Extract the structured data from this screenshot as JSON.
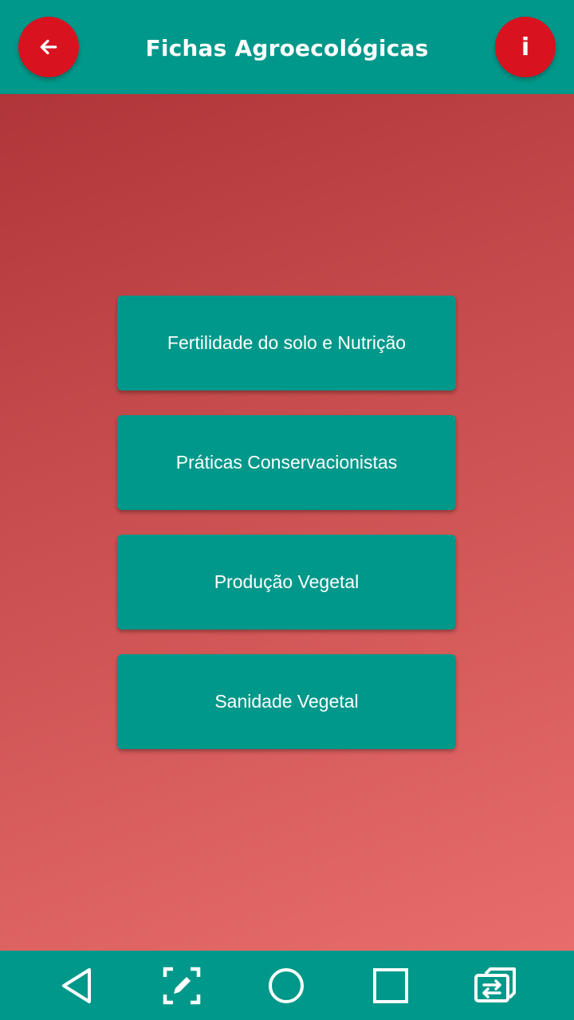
{
  "header": {
    "title": "Fichas Agroecológicas",
    "back_icon": "arrow-left-icon",
    "info_label": "i"
  },
  "menu": {
    "items": [
      {
        "label": "Fertilidade do solo e Nutrição"
      },
      {
        "label": "Práticas Conservacionistas"
      },
      {
        "label": "Produção Vegetal"
      },
      {
        "label": "Sanidade Vegetal"
      }
    ]
  },
  "nav_bar": {
    "icons": [
      "back-triangle-icon",
      "screenshot-edit-icon",
      "home-circle-icon",
      "recents-square-icon",
      "switch-app-icon"
    ]
  },
  "colors": {
    "primary": "#00988A",
    "accent": "#D8131F",
    "background_start": "#B0353A",
    "background_end": "#E86C6C"
  }
}
